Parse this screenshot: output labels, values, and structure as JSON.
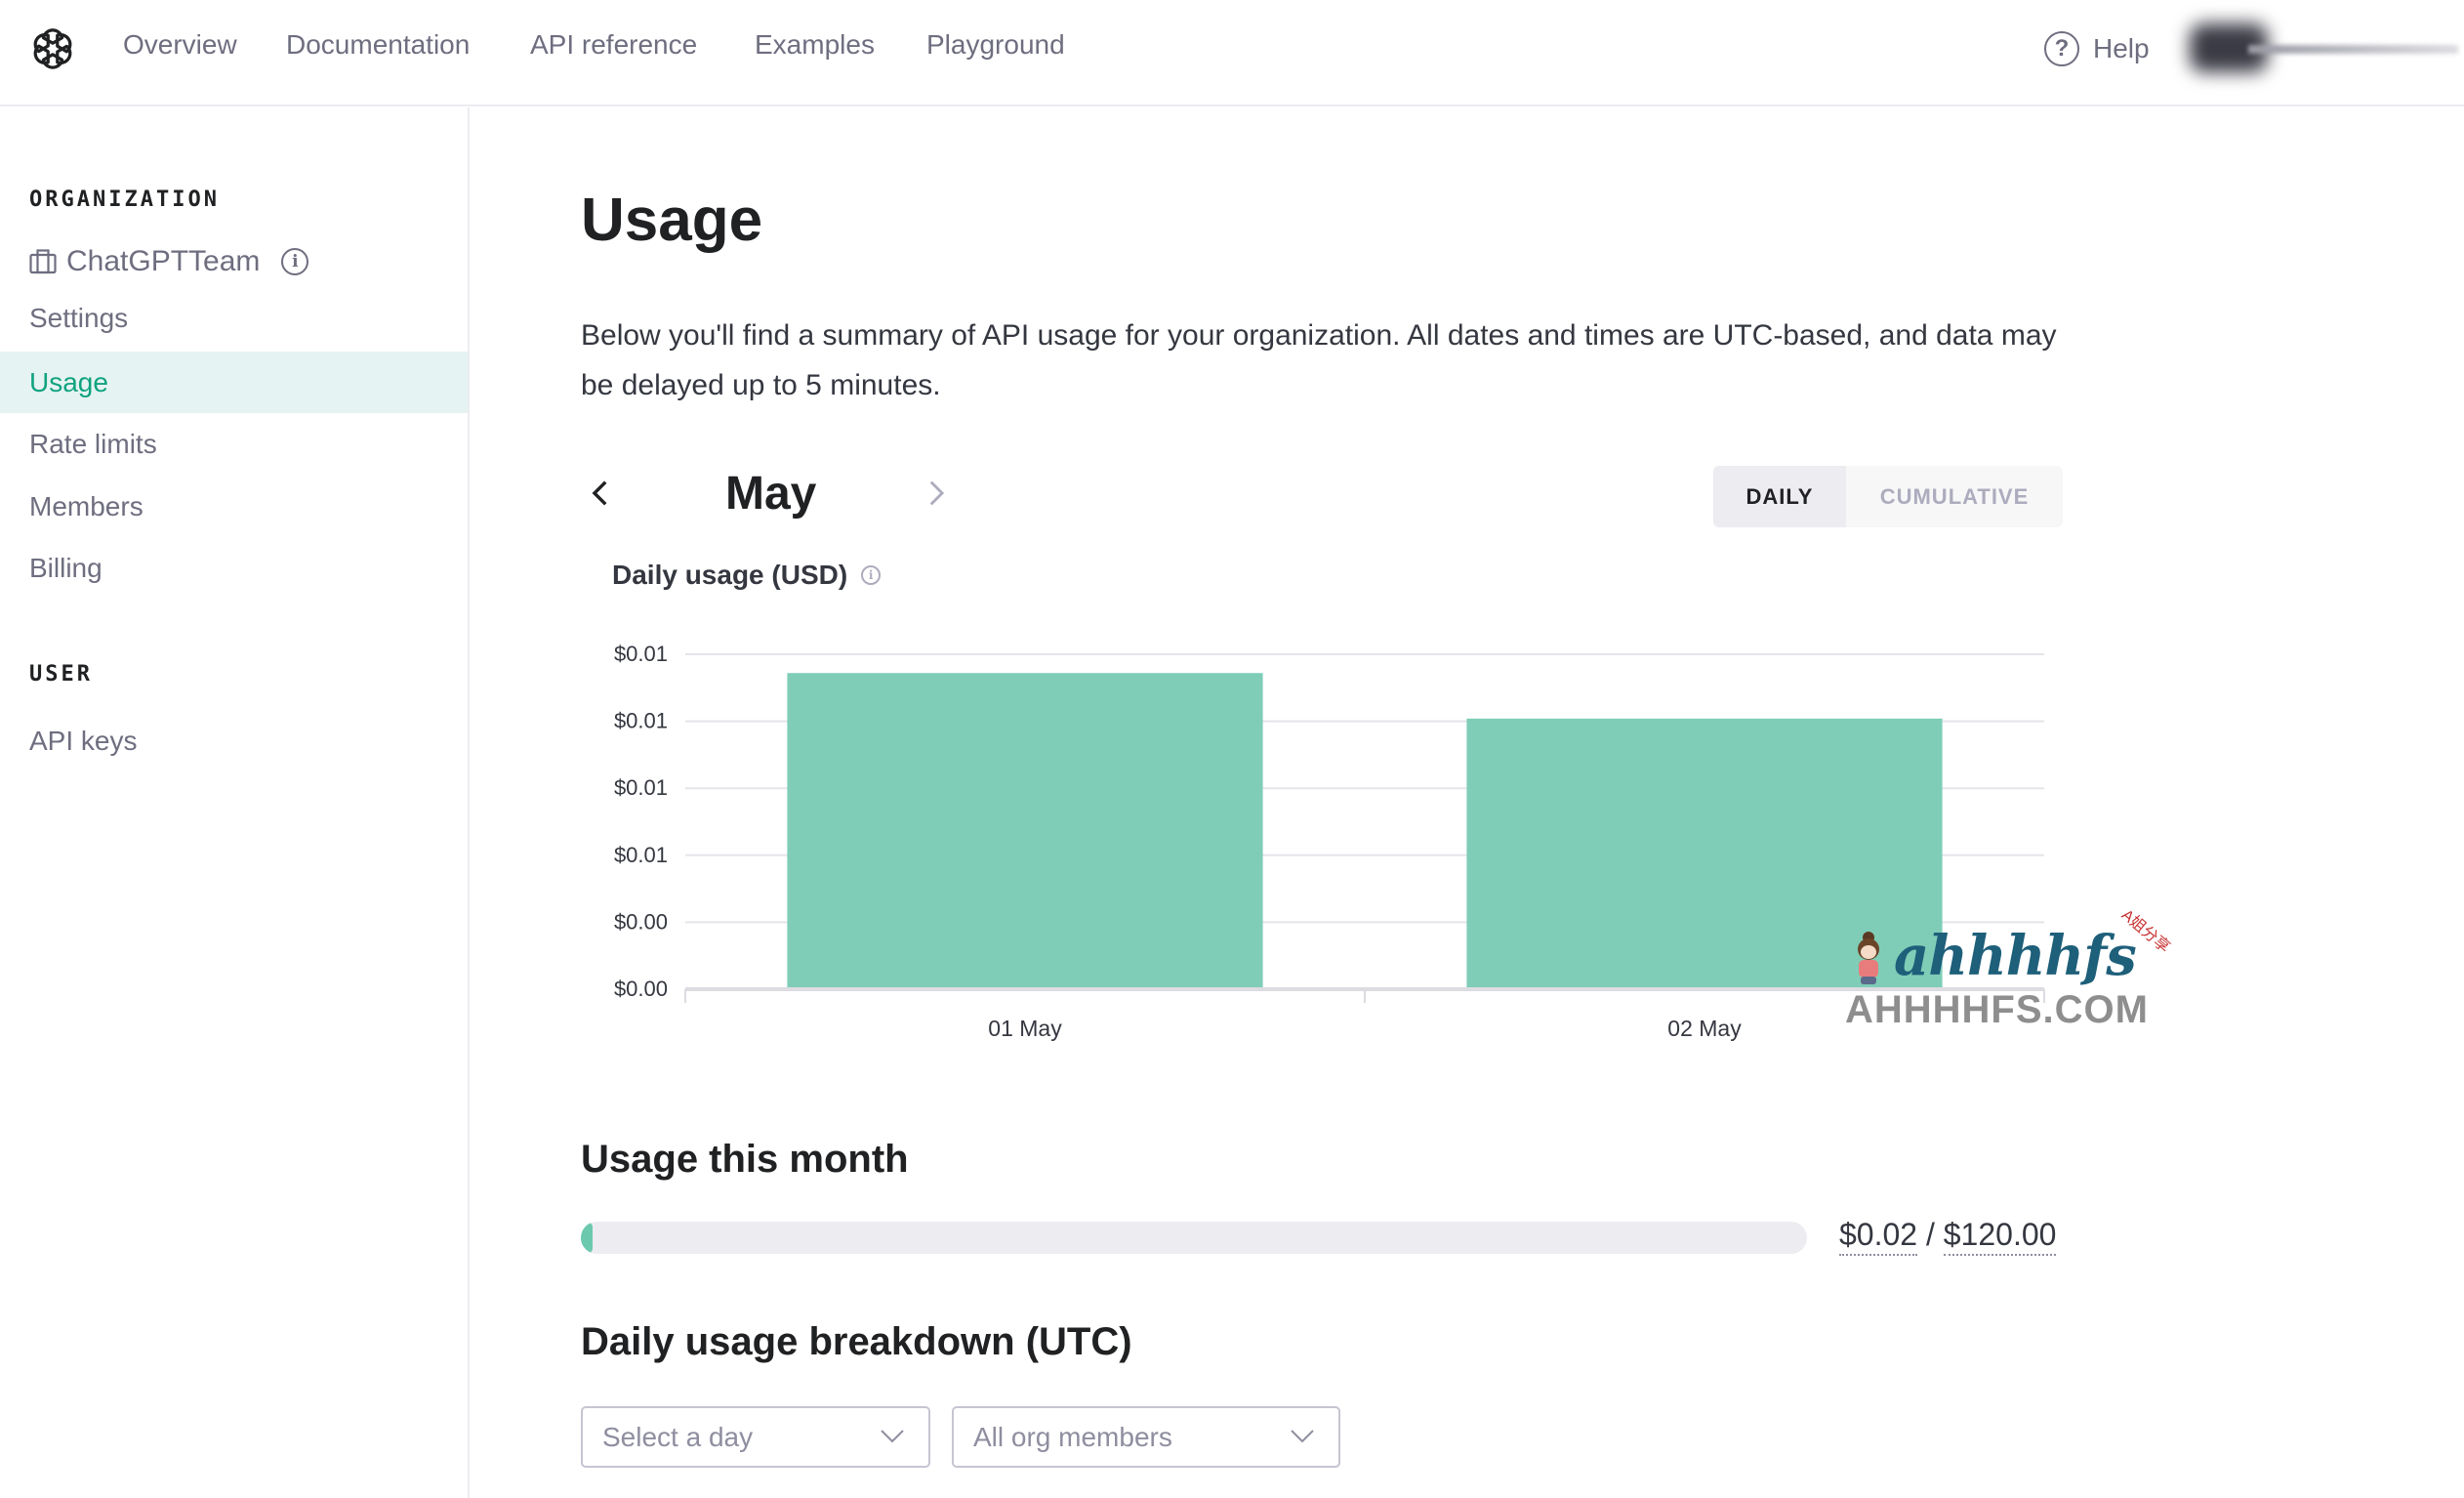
{
  "header": {
    "nav": [
      "Overview",
      "Documentation",
      "API reference",
      "Examples",
      "Playground"
    ],
    "help_label": "Help",
    "account_label": "(blurred account name)"
  },
  "sidebar": {
    "org_heading": "ORGANIZATION",
    "org_name": "ChatGPTTeam",
    "org_items": [
      {
        "label": "Settings",
        "active": false
      },
      {
        "label": "Usage",
        "active": true
      },
      {
        "label": "Rate limits",
        "active": false
      },
      {
        "label": "Members",
        "active": false
      },
      {
        "label": "Billing",
        "active": false
      }
    ],
    "user_heading": "USER",
    "user_items": [
      {
        "label": "API keys",
        "active": false
      }
    ]
  },
  "main": {
    "title": "Usage",
    "description": "Below you'll find a summary of API usage for your organization. All dates and times are UTC-based, and data may be delayed up to 5 minutes.",
    "month": "May",
    "toggle": {
      "daily": "DAILY",
      "cumulative": "CUMULATIVE",
      "selected": "DAILY"
    },
    "chart_title": "Daily usage (USD)",
    "usage_this_month": {
      "title": "Usage this month",
      "used": "$0.02",
      "separator": "/",
      "limit": "$120.00",
      "fraction": 0.000167
    },
    "breakdown": {
      "title": "Daily usage breakdown (UTC)",
      "day_select_placeholder": "Select a day",
      "member_select_value": "All org members"
    }
  },
  "colors": {
    "accent": "#10a37f",
    "bar": "#7fcdb7",
    "active_bg": "#e6f3f3",
    "progress_fill": "#6cc9ae"
  },
  "watermark": {
    "brand": "ahhhhfs",
    "site": "AHHHHFS.COM",
    "tag": "A姐分享"
  },
  "chart_data": {
    "type": "bar",
    "title": "Daily usage (USD)",
    "xlabel": "",
    "ylabel": "",
    "categories": [
      "01 May",
      "02 May"
    ],
    "values": [
      0.0118,
      0.0101
    ],
    "ylim": [
      0,
      0.0125
    ],
    "yticks": [
      0,
      0.0025,
      0.005,
      0.0075,
      0.01,
      0.0125
    ],
    "ytick_labels": [
      "$0.00",
      "$0.00",
      "$0.01",
      "$0.01",
      "$0.01",
      "$0.01"
    ],
    "grid": true,
    "legend": "none"
  }
}
